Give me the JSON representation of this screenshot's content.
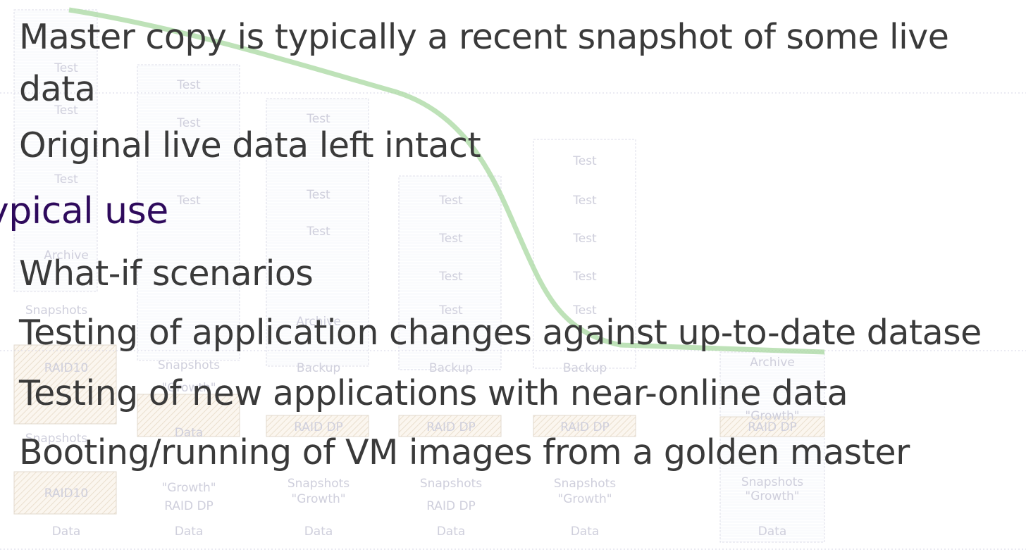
{
  "slide": {
    "lines": [
      {
        "text": "Master copy is typically a recent snapshot of some live",
        "kind": "bullet"
      },
      {
        "text": "data",
        "kind": "bullet"
      },
      {
        "text": "Original live data left intact",
        "kind": "bullet"
      },
      {
        "text": "ypical use",
        "kind": "heading"
      },
      {
        "text": "What-if scenarios",
        "kind": "bullet"
      },
      {
        "text": "Testing of application changes against up-to-date datase",
        "kind": "bullet"
      },
      {
        "text": "Testing of new applications with near-online data",
        "kind": "bullet"
      },
      {
        "text": "Booting/running of VM images from a golden master",
        "kind": "bullet"
      }
    ]
  },
  "background": {
    "labels": {
      "test": "Test",
      "archive": "Archive",
      "snapshots": "Snapshots",
      "raid10": "RAID10",
      "backup": "Backup",
      "growth": "\"Growth\"",
      "raid_dp": "RAID DP",
      "data": "Data"
    },
    "colors": {
      "text": "#3a3a3a",
      "heading": "#2e0a5c",
      "curve": "#a8d8a0",
      "disk_outline": "#c8c8d8"
    }
  }
}
